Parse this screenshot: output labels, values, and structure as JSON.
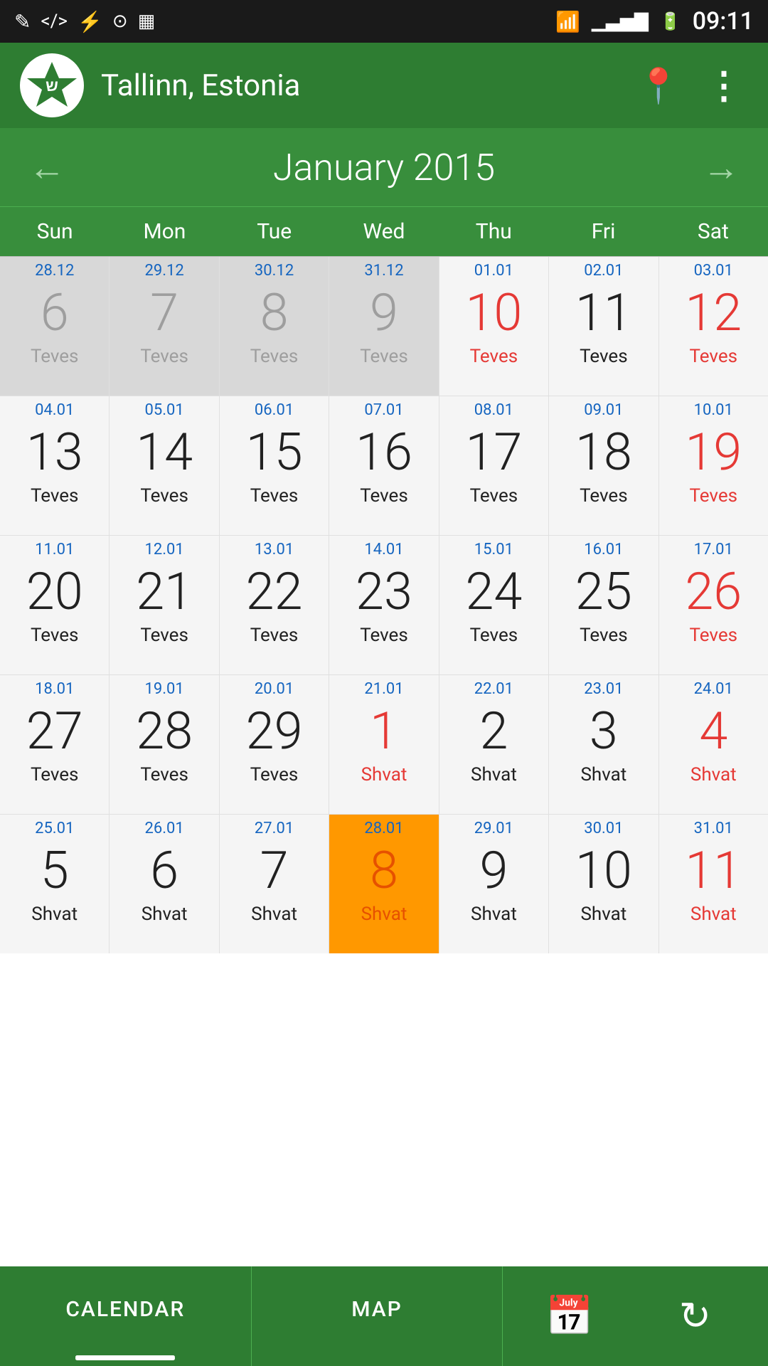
{
  "statusBar": {
    "time": "09:11",
    "leftIcons": [
      "✎",
      "◻",
      "⚡",
      "◎",
      "▦"
    ],
    "rightIcons": [
      "wifi",
      "signal",
      "battery"
    ]
  },
  "header": {
    "locationName": "Tallinn, Estonia",
    "locationIcon": "📍",
    "menuIcon": "⋮"
  },
  "monthNav": {
    "prevArrow": "←",
    "nextArrow": "→",
    "title": "January 2015"
  },
  "dayHeaders": [
    "Sun",
    "Mon",
    "Tue",
    "Wed",
    "Thu",
    "Fri",
    "Sat"
  ],
  "calendar": {
    "rows": [
      [
        {
          "small": "28.12",
          "main": "6",
          "hebrew": "Teves",
          "mainColor": "gray",
          "hebrewColor": "gray"
        },
        {
          "small": "29.12",
          "main": "7",
          "hebrew": "Teves",
          "mainColor": "gray",
          "hebrewColor": "gray"
        },
        {
          "small": "30.12",
          "main": "8",
          "hebrew": "Teves",
          "mainColor": "gray",
          "hebrewColor": "gray"
        },
        {
          "small": "31.12",
          "main": "9",
          "hebrew": "Teves",
          "mainColor": "gray",
          "hebrewColor": "gray"
        },
        {
          "small": "01.01",
          "main": "10",
          "hebrew": "Teves",
          "mainColor": "red",
          "hebrewColor": "red"
        },
        {
          "small": "02.01",
          "main": "11",
          "hebrew": "Teves",
          "mainColor": "black",
          "hebrewColor": "black"
        },
        {
          "small": "03.01",
          "main": "12",
          "hebrew": "Teves",
          "mainColor": "red",
          "hebrewColor": "red"
        }
      ],
      [
        {
          "small": "04.01",
          "main": "13",
          "hebrew": "Teves",
          "mainColor": "black",
          "hebrewColor": "black"
        },
        {
          "small": "05.01",
          "main": "14",
          "hebrew": "Teves",
          "mainColor": "black",
          "hebrewColor": "black"
        },
        {
          "small": "06.01",
          "main": "15",
          "hebrew": "Teves",
          "mainColor": "black",
          "hebrewColor": "black"
        },
        {
          "small": "07.01",
          "main": "16",
          "hebrew": "Teves",
          "mainColor": "black",
          "hebrewColor": "black"
        },
        {
          "small": "08.01",
          "main": "17",
          "hebrew": "Teves",
          "mainColor": "black",
          "hebrewColor": "black"
        },
        {
          "small": "09.01",
          "main": "18",
          "hebrew": "Teves",
          "mainColor": "black",
          "hebrewColor": "black"
        },
        {
          "small": "10.01",
          "main": "19",
          "hebrew": "Teves",
          "mainColor": "red",
          "hebrewColor": "red"
        }
      ],
      [
        {
          "small": "11.01",
          "main": "20",
          "hebrew": "Teves",
          "mainColor": "black",
          "hebrewColor": "black"
        },
        {
          "small": "12.01",
          "main": "21",
          "hebrew": "Teves",
          "mainColor": "black",
          "hebrewColor": "black"
        },
        {
          "small": "13.01",
          "main": "22",
          "hebrew": "Teves",
          "mainColor": "black",
          "hebrewColor": "black"
        },
        {
          "small": "14.01",
          "main": "23",
          "hebrew": "Teves",
          "mainColor": "black",
          "hebrewColor": "black"
        },
        {
          "small": "15.01",
          "main": "24",
          "hebrew": "Teves",
          "mainColor": "black",
          "hebrewColor": "black"
        },
        {
          "small": "16.01",
          "main": "25",
          "hebrew": "Teves",
          "mainColor": "black",
          "hebrewColor": "black"
        },
        {
          "small": "17.01",
          "main": "26",
          "hebrew": "Teves",
          "mainColor": "red",
          "hebrewColor": "red"
        }
      ],
      [
        {
          "small": "18.01",
          "main": "27",
          "hebrew": "Teves",
          "mainColor": "black",
          "hebrewColor": "black"
        },
        {
          "small": "19.01",
          "main": "28",
          "hebrew": "Teves",
          "mainColor": "black",
          "hebrewColor": "black"
        },
        {
          "small": "20.01",
          "main": "29",
          "hebrew": "Teves",
          "mainColor": "black",
          "hebrewColor": "black"
        },
        {
          "small": "21.01",
          "main": "1",
          "hebrew": "Shvat",
          "mainColor": "red",
          "hebrewColor": "red"
        },
        {
          "small": "22.01",
          "main": "2",
          "hebrew": "Shvat",
          "mainColor": "black",
          "hebrewColor": "black"
        },
        {
          "small": "23.01",
          "main": "3",
          "hebrew": "Shvat",
          "mainColor": "black",
          "hebrewColor": "black"
        },
        {
          "small": "24.01",
          "main": "4",
          "hebrew": "Shvat",
          "mainColor": "red",
          "hebrewColor": "red"
        }
      ],
      [
        {
          "small": "25.01",
          "main": "5",
          "hebrew": "Shvat",
          "mainColor": "black",
          "hebrewColor": "black"
        },
        {
          "small": "26.01",
          "main": "6",
          "hebrew": "Shvat",
          "mainColor": "black",
          "hebrewColor": "black"
        },
        {
          "small": "27.01",
          "main": "7",
          "hebrew": "Shvat",
          "mainColor": "black",
          "hebrewColor": "black"
        },
        {
          "small": "28.01",
          "main": "8",
          "hebrew": "Shvat",
          "mainColor": "orange",
          "hebrewColor": "orange",
          "today": true
        },
        {
          "small": "29.01",
          "main": "9",
          "hebrew": "Shvat",
          "mainColor": "black",
          "hebrewColor": "black"
        },
        {
          "small": "30.01",
          "main": "10",
          "hebrew": "Shvat",
          "mainColor": "black",
          "hebrewColor": "black"
        },
        {
          "small": "31.01",
          "main": "11",
          "hebrew": "Shvat",
          "mainColor": "red",
          "hebrewColor": "red"
        }
      ]
    ]
  },
  "bottomNav": {
    "tabs": [
      {
        "label": "CALENDAR",
        "active": true
      },
      {
        "label": "MAP",
        "active": false
      }
    ],
    "calendarIcon": "📅",
    "refreshIcon": "↻"
  }
}
